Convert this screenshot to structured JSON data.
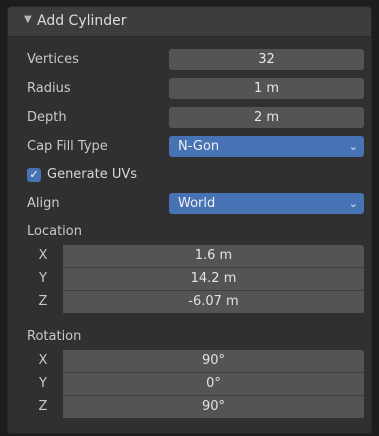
{
  "panel": {
    "title": "Add Cylinder",
    "collapse_icon": "triangle-down-icon"
  },
  "fields": {
    "vertices": {
      "label": "Vertices",
      "value": "32"
    },
    "radius": {
      "label": "Radius",
      "value": "1 m"
    },
    "depth": {
      "label": "Depth",
      "value": "2 m"
    },
    "cap_fill_type": {
      "label": "Cap Fill Type",
      "value": "N-Gon"
    },
    "generate_uvs": {
      "label": "Generate UVs",
      "checked": true
    },
    "align": {
      "label": "Align",
      "value": "World"
    }
  },
  "location": {
    "label": "Location",
    "x": {
      "axis": "X",
      "value": "1.6 m"
    },
    "y": {
      "axis": "Y",
      "value": "14.2 m"
    },
    "z": {
      "axis": "Z",
      "value": "-6.07 m"
    }
  },
  "rotation": {
    "label": "Rotation",
    "x": {
      "axis": "X",
      "value": "90°"
    },
    "y": {
      "axis": "Y",
      "value": "0°"
    },
    "z": {
      "axis": "Z",
      "value": "90°"
    }
  },
  "colors": {
    "accent": "#4772b3",
    "panel_bg": "#303030",
    "field_bg": "#545454"
  }
}
